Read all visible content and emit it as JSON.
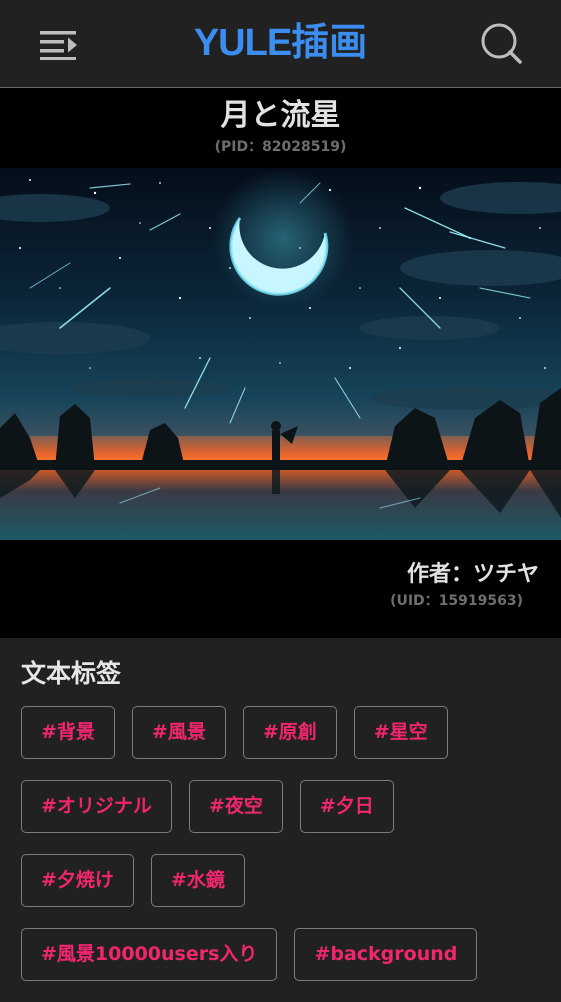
{
  "header": {
    "logo_latin": "YULE",
    "logo_cjk": "插画",
    "menu_icon": "menu-collapse-icon",
    "search_icon": "search-icon",
    "accent_color": "#3b8df0"
  },
  "work": {
    "title": "月と流星",
    "pid_text": "(PID：82028519)",
    "author_text": "作者：ツチヤ",
    "uid_text": "(UID：15919563)"
  },
  "tags": {
    "section_title": "文本标签",
    "tag_color": "#f0266e",
    "rows": [
      [
        "#背景",
        "#風景",
        "#原創",
        "#星空"
      ],
      [
        "#オリジナル",
        "#夜空",
        "#夕日"
      ],
      [
        "#夕焼け",
        "#水鏡"
      ],
      [
        "#風景10000users入り",
        "#background"
      ]
    ]
  }
}
